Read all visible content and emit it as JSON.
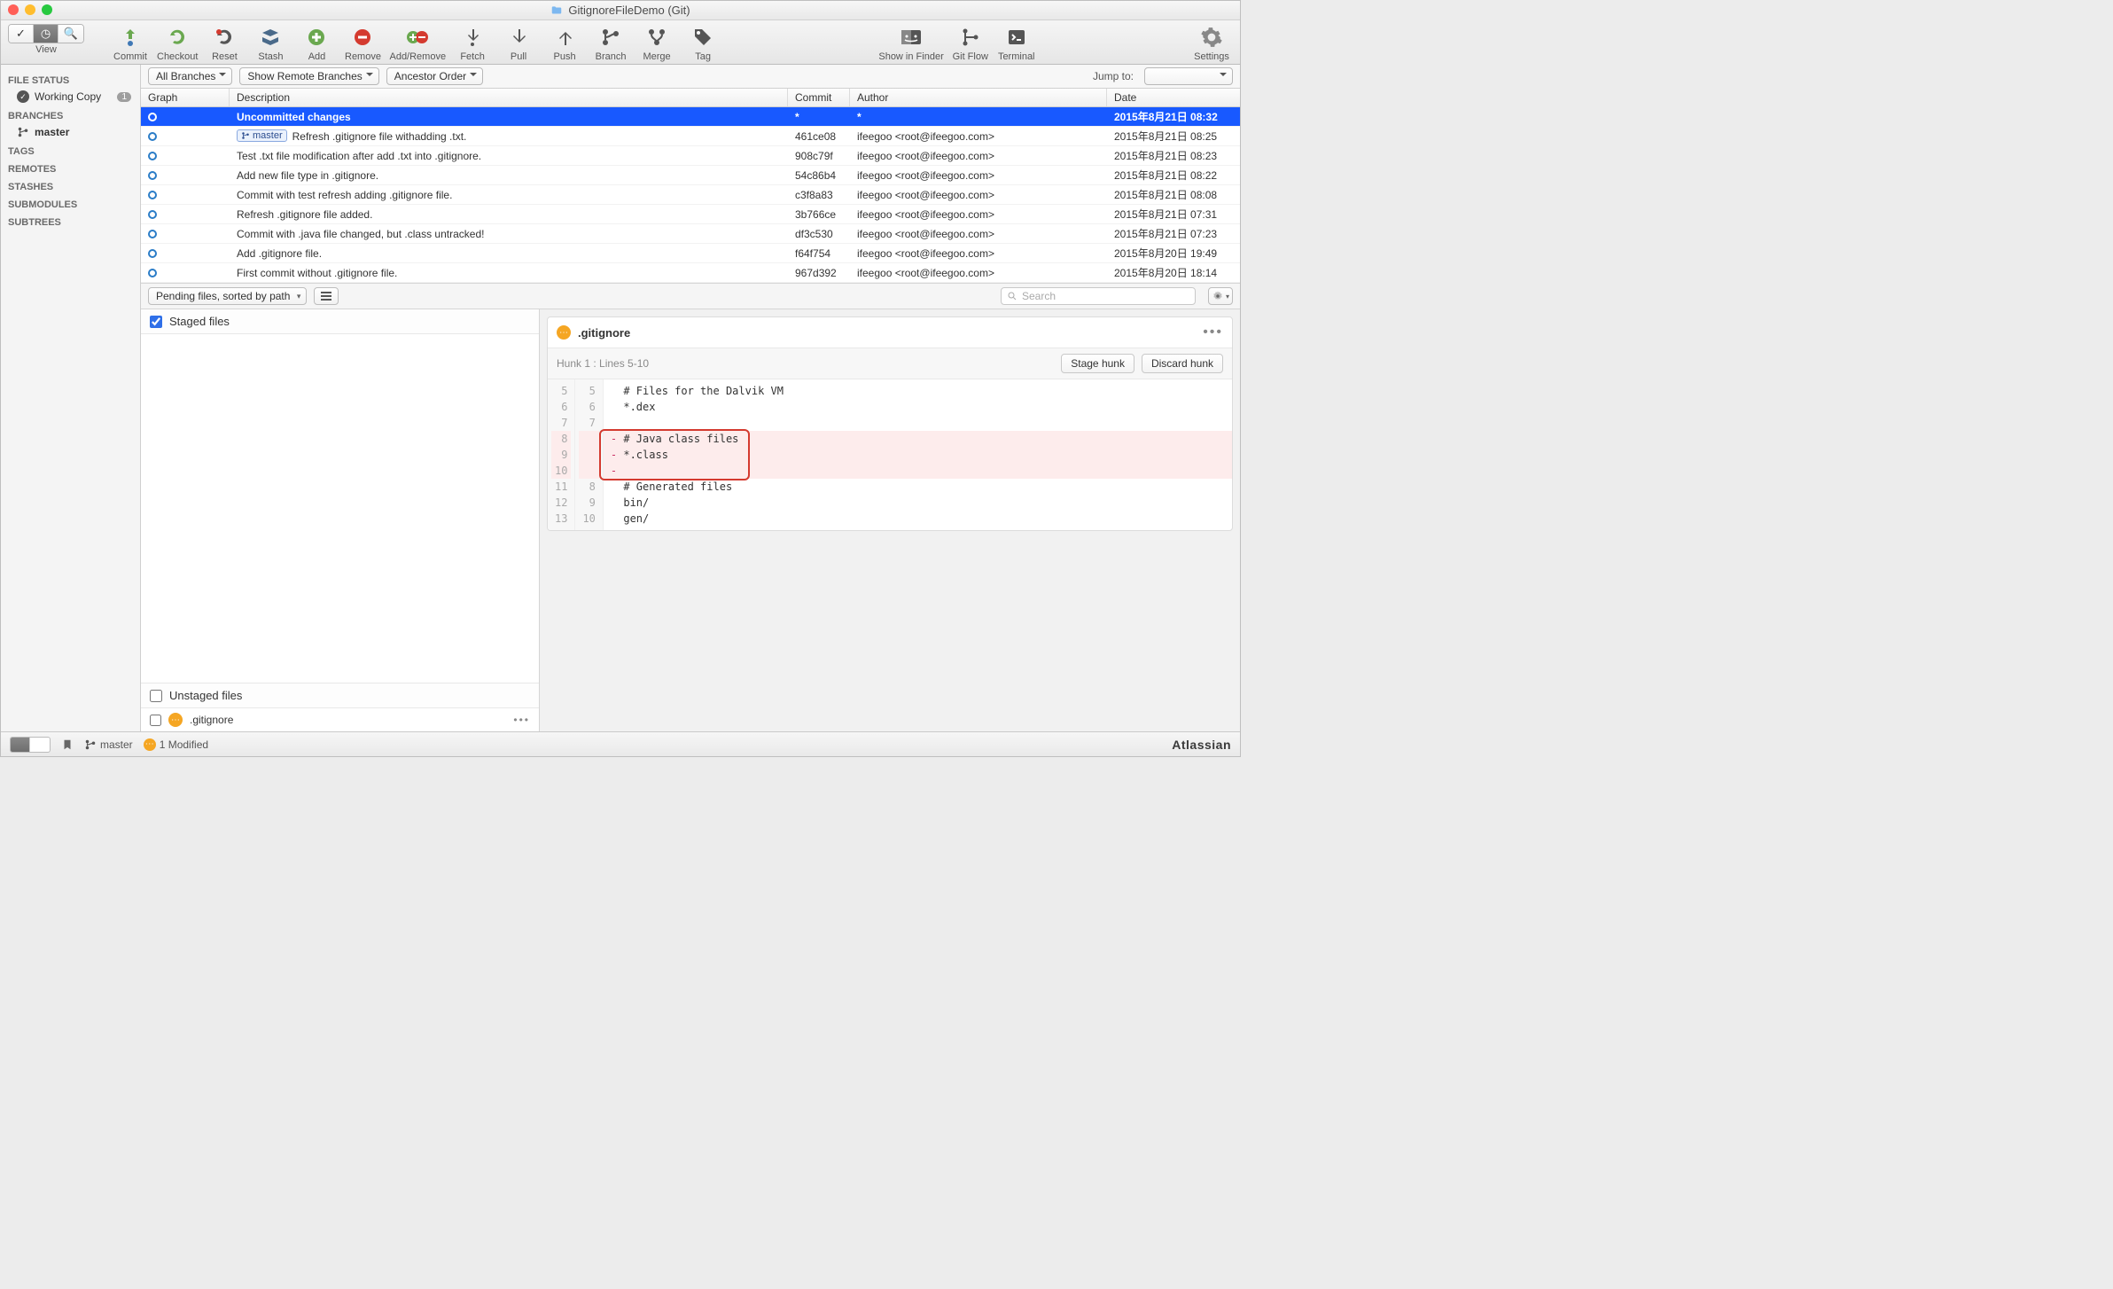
{
  "window": {
    "title": "GitignoreFileDemo (Git)"
  },
  "toolbar": {
    "view": "View",
    "commit": "Commit",
    "checkout": "Checkout",
    "reset": "Reset",
    "stash": "Stash",
    "add": "Add",
    "remove": "Remove",
    "addremove": "Add/Remove",
    "fetch": "Fetch",
    "pull": "Pull",
    "push": "Push",
    "branch": "Branch",
    "merge": "Merge",
    "tag": "Tag",
    "showfinder": "Show in Finder",
    "gitflow": "Git Flow",
    "terminal": "Terminal",
    "settings": "Settings"
  },
  "filter": {
    "allbranches": "All Branches",
    "showremote": "Show Remote Branches",
    "ancestor": "Ancestor Order",
    "jumpto": "Jump to:"
  },
  "sidebar": {
    "filestatus": "FILE STATUS",
    "workingcopy": "Working Copy",
    "workingcopy_badge": "1",
    "branches": "BRANCHES",
    "master": "master",
    "tags": "TAGS",
    "remotes": "REMOTES",
    "stashes": "STASHES",
    "submodules": "SUBMODULES",
    "subtrees": "SUBTREES"
  },
  "columns": {
    "graph": "Graph",
    "description": "Description",
    "commit": "Commit",
    "author": "Author",
    "date": "Date"
  },
  "commits": [
    {
      "desc": "Uncommitted changes",
      "hash": "*",
      "author": "*",
      "date": "2015年8月21日 08:32",
      "selected": true
    },
    {
      "branch": "master",
      "desc": "Refresh .gitignore file withadding .txt.",
      "hash": "461ce08",
      "author": "ifeegoo <root@ifeegoo.com>",
      "date": "2015年8月21日 08:25"
    },
    {
      "desc": "Test .txt file modification after add .txt into .gitignore.",
      "hash": "908c79f",
      "author": "ifeegoo <root@ifeegoo.com>",
      "date": "2015年8月21日 08:23"
    },
    {
      "desc": "Add new file type in .gitignore.",
      "hash": "54c86b4",
      "author": "ifeegoo <root@ifeegoo.com>",
      "date": "2015年8月21日 08:22"
    },
    {
      "desc": "Commit with test refresh adding .gitignore file.",
      "hash": "c3f8a83",
      "author": "ifeegoo <root@ifeegoo.com>",
      "date": "2015年8月21日 08:08"
    },
    {
      "desc": "Refresh .gitignore file added.",
      "hash": "3b766ce",
      "author": "ifeegoo <root@ifeegoo.com>",
      "date": "2015年8月21日 07:31"
    },
    {
      "desc": "Commit with .java file changed, but .class untracked!",
      "hash": "df3c530",
      "author": "ifeegoo <root@ifeegoo.com>",
      "date": "2015年8月21日 07:23"
    },
    {
      "desc": "Add .gitignore file.",
      "hash": "f64f754",
      "author": "ifeegoo <root@ifeegoo.com>",
      "date": "2015年8月20日 19:49"
    },
    {
      "desc": "First commit without .gitignore file.",
      "hash": "967d392",
      "author": "ifeegoo <root@ifeegoo.com>",
      "date": "2015年8月20日 18:14"
    }
  ],
  "midbar": {
    "sort": "Pending files, sorted by path",
    "search_placeholder": "Search"
  },
  "files": {
    "staged": "Staged files",
    "unstaged": "Unstaged files",
    "gitignore": ".gitignore"
  },
  "diff": {
    "filename": ".gitignore",
    "hunk": "Hunk 1 : Lines 5-10",
    "stage_hunk": "Stage hunk",
    "discard_hunk": "Discard hunk",
    "lines": [
      {
        "old": "5",
        "new": "5",
        "text": "# Files for the Dalvik VM",
        "type": "ctx"
      },
      {
        "old": "6",
        "new": "6",
        "text": "*.dex",
        "type": "ctx"
      },
      {
        "old": "7",
        "new": "7",
        "text": "",
        "type": "ctx"
      },
      {
        "old": "8",
        "new": "",
        "text": "# Java class files",
        "type": "del"
      },
      {
        "old": "9",
        "new": "",
        "text": "*.class",
        "type": "del"
      },
      {
        "old": "10",
        "new": "",
        "text": "",
        "type": "del"
      },
      {
        "old": "11",
        "new": "8",
        "text": "# Generated files",
        "type": "ctx"
      },
      {
        "old": "12",
        "new": "9",
        "text": "bin/",
        "type": "ctx"
      },
      {
        "old": "13",
        "new": "10",
        "text": "gen/",
        "type": "ctx"
      }
    ]
  },
  "status": {
    "branch": "master",
    "modified": "1 Modified",
    "brand": "Atlassian"
  }
}
